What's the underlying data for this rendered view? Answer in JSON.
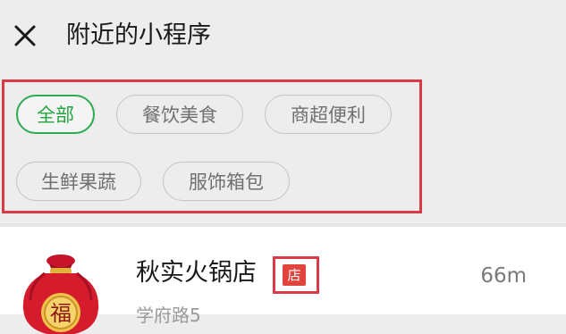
{
  "header": {
    "title": "附近的小程序",
    "close_icon": "close-icon"
  },
  "filters": {
    "chips": [
      {
        "label": "全部",
        "active": true
      },
      {
        "label": "餐饮美食",
        "active": false
      },
      {
        "label": "商超便利",
        "active": false
      },
      {
        "label": "生鲜果蔬",
        "active": false
      },
      {
        "label": "服饰箱包",
        "active": false
      }
    ]
  },
  "list": {
    "items": [
      {
        "name": "秋实火锅店",
        "badge": "店",
        "distance": "66m",
        "address": "学府路5",
        "logo_text": "福",
        "logo_icon": "fortune-bag-icon"
      }
    ]
  },
  "colors": {
    "accent_green": "#21a63e",
    "highlight_red": "#d93b48",
    "badge_red": "#e0443c",
    "background": "#ededed"
  }
}
